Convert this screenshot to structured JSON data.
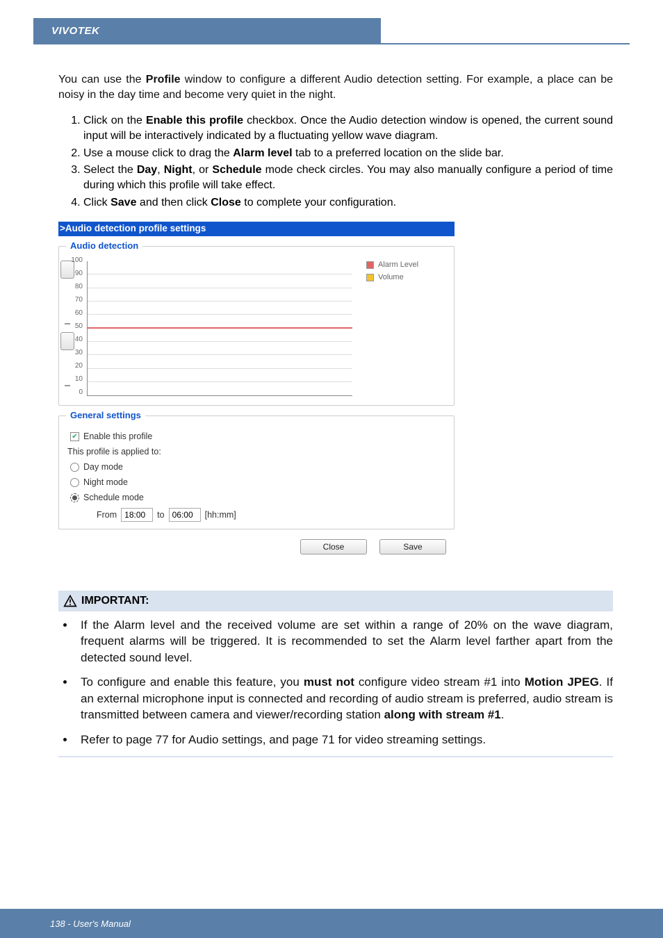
{
  "header": {
    "brand": "VIVOTEK"
  },
  "intro": {
    "pre": "You can use the ",
    "bold1": "Profile",
    "post1": " window to configure a different Audio detection setting. For example, a place can be noisy in the day time and become very quiet in the night."
  },
  "steps": [
    {
      "pre": "Click on the ",
      "bold": "Enable this profile",
      "post": " checkbox. Once the Audio detection window is opened, the current sound input will be interactively indicated by a fluctuating yellow wave diagram."
    },
    {
      "pre": "Use a mouse click to drag the ",
      "bold": "Alarm level",
      "post": " tab to a preferred location on the slide bar."
    },
    {
      "pre": "Select the ",
      "bold": "Day",
      "mid": ", ",
      "bold2": "Night",
      "mid2": ", or ",
      "bold3": "Schedule",
      "post": " mode check circles. You may also manually configure a period of time during which this profile will take effect."
    },
    {
      "pre": "Click ",
      "bold": "Save",
      "mid": " and then click ",
      "bold2": "Close",
      "post": " to complete your configuration."
    }
  ],
  "ui": {
    "title": ">Audio detection profile settings",
    "section1": "Audio detection",
    "legend_alarm": "Alarm Level",
    "legend_volume": "Volume",
    "section2": "General settings",
    "enable_label": "Enable this profile",
    "applied_label": "This profile is applied to:",
    "opt_day": "Day mode",
    "opt_night": "Night mode",
    "opt_schedule": "Schedule mode",
    "from_label": "From",
    "from_value": "18:00",
    "to_label": "to",
    "to_value": "06:00",
    "hhmm": "[hh:mm]",
    "btn_close": "Close",
    "btn_save": "Save"
  },
  "chart_data": {
    "type": "line",
    "title": "Audio detection",
    "ylabel": "",
    "ylim": [
      0,
      100
    ],
    "ticks": [
      0,
      10,
      20,
      30,
      40,
      50,
      60,
      70,
      80,
      90,
      100
    ],
    "series": [
      {
        "name": "Alarm Level",
        "values": [
          50
        ],
        "color": "#e06666"
      },
      {
        "name": "Volume",
        "values": [],
        "color": "#f1c232"
      }
    ],
    "alarm_level": 50,
    "slider_thumbs": [
      85,
      40
    ]
  },
  "important": {
    "heading": "IMPORTANT:",
    "items": [
      {
        "text": "If the Alarm level and the received volume are set within a range of 20% on the wave diagram, frequent alarms will be triggered. It is recommended to set the Alarm level farther apart from the detected sound level."
      },
      {
        "pre": "To configure and enable this feature, you ",
        "b1": "must not",
        "mid1": " configure video stream #1 into ",
        "b2": "Motion JPEG",
        "mid2": ". If an external microphone input is connected and recording of audio stream is preferred, audio stream is transmitted between camera and viewer/recording station ",
        "b3": "along with stream #1",
        "post": "."
      },
      {
        "text": "Refer to page 77 for Audio settings, and page 71 for video streaming settings."
      }
    ]
  },
  "footer": {
    "text": "138 - User's Manual"
  }
}
